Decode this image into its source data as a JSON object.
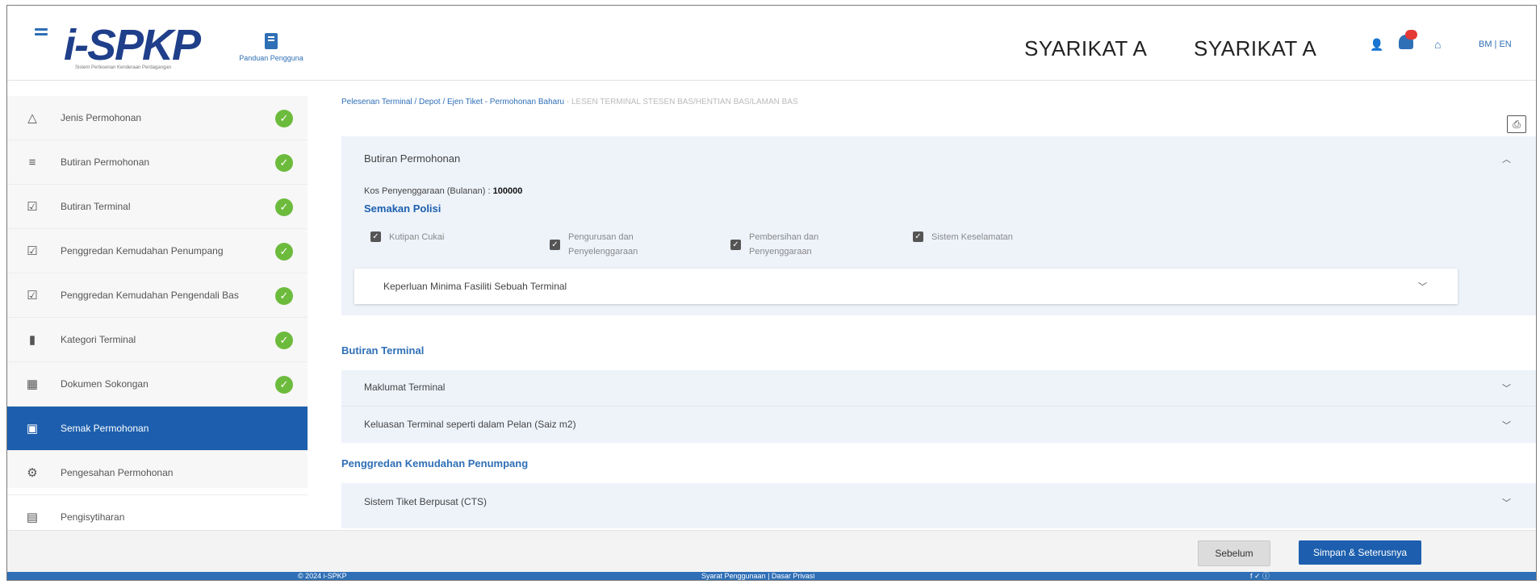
{
  "header": {
    "logo_text": "i-SPKP",
    "logo_subtitle": "Sistem Perlesenan Kenderaan Perdagangan",
    "guide_label": "Panduan Pengguna",
    "company_1": "SYARIKAT A",
    "company_2": "SYARIKAT A",
    "lang": "BM | EN"
  },
  "sidebar": {
    "items": [
      {
        "label": "Jenis Permohonan",
        "icon": "warning-triangle-icon",
        "completed": true
      },
      {
        "label": "Butiran Permohonan",
        "icon": "filter-icon",
        "completed": true
      },
      {
        "label": "Butiran Terminal",
        "icon": "checklist-icon",
        "completed": true
      },
      {
        "label": "Penggredan Kemudahan Penumpang",
        "icon": "checklist-icon",
        "completed": true
      },
      {
        "label": "Penggredan Kemudahan Pengendali Bas",
        "icon": "checklist-icon",
        "completed": true
      },
      {
        "label": "Kategori Terminal",
        "icon": "document-icon",
        "completed": true
      },
      {
        "label": "Dokumen Sokongan",
        "icon": "documents-icon",
        "completed": true
      },
      {
        "label": "Semak Permohonan",
        "icon": "review-icon",
        "completed": false,
        "active": true
      },
      {
        "label": "Pengesahan Permohonan",
        "icon": "gear-icon",
        "completed": false
      },
      {
        "label": "Pengisytiharan",
        "icon": "declaration-icon",
        "completed": false
      }
    ]
  },
  "breadcrumb": {
    "path": "Pelesenan Terminal / Depot / Ejen Tiket - Permohonan Baharu",
    "current": "- LESEN TERMINAL STESEN BAS/HENTIAN BAS/LAMAN BAS"
  },
  "butiran_permohonan": {
    "title": "Butiran Permohonan",
    "kos_label": "Kos Penyenggaraan (Bulanan) :",
    "kos_value": "100000",
    "semakan_title": "Semakan Polisi",
    "checkboxes": [
      {
        "label": "Kutipan Cukai",
        "checked": true
      },
      {
        "label": "Pengurusan dan Penyelenggaraan",
        "checked": true
      },
      {
        "label": "Pembersihan dan Penyenggaraan",
        "checked": true
      },
      {
        "label": "Sistem Keselamatan",
        "checked": true
      }
    ],
    "keperluan": "Keperluan Minima Fasiliti Sebuah Terminal"
  },
  "butiran_terminal": {
    "title": "Butiran Terminal",
    "rows": [
      "Maklumat Terminal",
      "Keluasan Terminal seperti dalam Pelan (Saiz m2)"
    ]
  },
  "penggredan": {
    "title": "Penggredan Kemudahan Penumpang",
    "rows": [
      "Sistem Tiket Berpusat (CTS)"
    ]
  },
  "actions": {
    "prev": "Sebelum",
    "next": "Simpan & Seterusnya"
  },
  "footer": {
    "copyright": "© 2024 i-SPKP",
    "links": "Syarat Penggunaan | Dasar Privasi",
    "social": "f ✓ ⓘ"
  },
  "colors": {
    "primary": "#1d5fae",
    "complete": "#6dbb3d",
    "panel": "#eef3fa"
  }
}
